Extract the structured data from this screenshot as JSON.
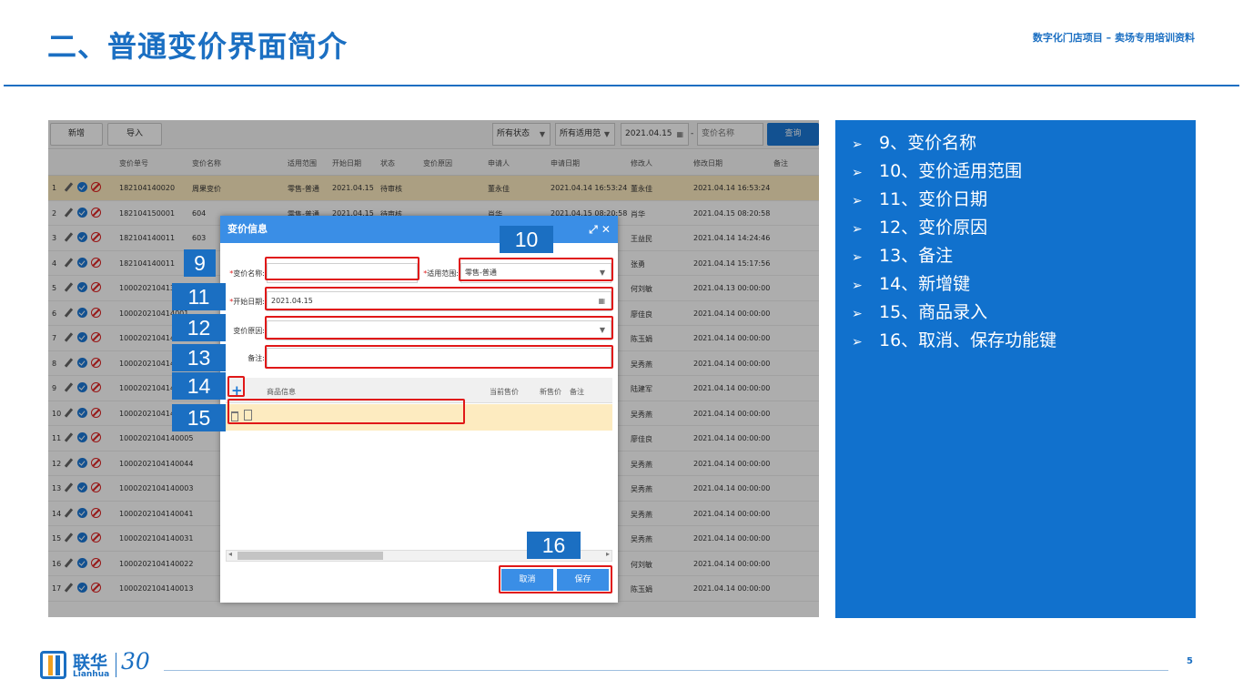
{
  "slide": {
    "title": "二、普通变价界面简介",
    "subtitle": "数字化门店项目 – 卖场专用培训资料",
    "page_number": "5"
  },
  "toolbar": {
    "add_label": "新增",
    "import_label": "导入",
    "status_filter": "所有状态",
    "scope_filter": "所有适用范",
    "date_value": "2021.04.15",
    "date_sep": "-",
    "name_placeholder": "变价名称",
    "query_label": "查询"
  },
  "grid": {
    "columns": [
      "变价单号",
      "变价名称",
      "适用范围",
      "开始日期",
      "状态",
      "变价原因",
      "申请人",
      "申请日期",
      "修改人",
      "修改日期",
      "备注"
    ],
    "rows": [
      {
        "num": "1",
        "order": "182104140020",
        "name": "周果变价",
        "scope": "零售-普通",
        "start": "2021.04.15",
        "status": "待审核",
        "applicant": "董永佳",
        "apply_date": "2021.04.14 16:53:24",
        "modifier": "董永佳",
        "mod_date": "2021.04.14 16:53:24"
      },
      {
        "num": "2",
        "order": "182104150001",
        "name": "604",
        "scope": "零售-普通",
        "start": "2021.04.15",
        "status": "待审核",
        "applicant": "肖华",
        "apply_date": "2021.04.15 08:20:58",
        "modifier": "肖华",
        "mod_date": "2021.04.15 08:20:58"
      },
      {
        "num": "3",
        "order": "182104140011",
        "name": "603",
        "scope": "",
        "start": "",
        "status": "",
        "applicant": "",
        "apply_date": "",
        "modifier": "王益民",
        "mod_date": "2021.04.14 14:24:46"
      },
      {
        "num": "4",
        "order": "182104140011",
        "name": "",
        "scope": "",
        "start": "",
        "status": "",
        "applicant": "",
        "apply_date": "",
        "modifier": "张勇",
        "mod_date": "2021.04.14 15:17:56"
      },
      {
        "num": "5",
        "order": "100020210413001",
        "name": "",
        "scope": "",
        "start": "",
        "status": "",
        "applicant": "",
        "apply_date": "",
        "modifier": "何刘敏",
        "mod_date": "2021.04.13 00:00:00"
      },
      {
        "num": "6",
        "order": "100020210414001",
        "name": "",
        "scope": "",
        "start": "",
        "status": "",
        "applicant": "",
        "apply_date": "",
        "modifier": "廖佳良",
        "mod_date": "2021.04.14 00:00:00"
      },
      {
        "num": "7",
        "order": "100020210414001",
        "name": "",
        "scope": "",
        "start": "",
        "status": "",
        "applicant": "",
        "apply_date": "",
        "modifier": "陈玉娟",
        "mod_date": "2021.04.14 00:00:00"
      },
      {
        "num": "8",
        "order": "100020210414001",
        "name": "",
        "scope": "",
        "start": "",
        "status": "",
        "applicant": "",
        "apply_date": "",
        "modifier": "吴秀燕",
        "mod_date": "2021.04.14 00:00:00"
      },
      {
        "num": "9",
        "order": "100020210414001",
        "name": "",
        "scope": "",
        "start": "",
        "status": "",
        "applicant": "",
        "apply_date": "",
        "modifier": "陆建军",
        "mod_date": "2021.04.14 00:00:00"
      },
      {
        "num": "10",
        "order": "100020210414001",
        "name": "",
        "scope": "",
        "start": "",
        "status": "",
        "applicant": "",
        "apply_date": "",
        "modifier": "吴秀燕",
        "mod_date": "2021.04.14 00:00:00"
      },
      {
        "num": "11",
        "order": "1000202104140005",
        "name": "",
        "scope": "",
        "start": "",
        "status": "",
        "applicant": "",
        "apply_date": "",
        "modifier": "廖佳良",
        "mod_date": "2021.04.14 00:00:00"
      },
      {
        "num": "12",
        "order": "1000202104140044",
        "name": "",
        "scope": "",
        "start": "",
        "status": "",
        "applicant": "",
        "apply_date": "",
        "modifier": "吴秀燕",
        "mod_date": "2021.04.14 00:00:00"
      },
      {
        "num": "13",
        "order": "1000202104140003",
        "name": "",
        "scope": "",
        "start": "",
        "status": "",
        "applicant": "",
        "apply_date": "",
        "modifier": "吴秀燕",
        "mod_date": "2021.04.14 00:00:00"
      },
      {
        "num": "14",
        "order": "1000202104140041",
        "name": "",
        "scope": "",
        "start": "",
        "status": "",
        "applicant": "",
        "apply_date": "",
        "modifier": "吴秀燕",
        "mod_date": "2021.04.14 00:00:00"
      },
      {
        "num": "15",
        "order": "1000202104140031",
        "name": "",
        "scope": "",
        "start": "",
        "status": "",
        "applicant": "",
        "apply_date": "",
        "modifier": "吴秀燕",
        "mod_date": "2021.04.14 00:00:00"
      },
      {
        "num": "16",
        "order": "1000202104140022",
        "name": "",
        "scope": "",
        "start": "",
        "status": "",
        "applicant": "",
        "apply_date": "",
        "modifier": "何刘敏",
        "mod_date": "2021.04.14 00:00:00"
      },
      {
        "num": "17",
        "order": "1000202104140013",
        "name": "",
        "scope": "",
        "start": "",
        "status": "",
        "applicant": "",
        "apply_date": "",
        "modifier": "陈玉娟",
        "mod_date": "2021.04.14 00:00:00"
      }
    ]
  },
  "dialog": {
    "title": "变价信息",
    "ctrl": "⤢ ✕",
    "name_label": "变价名称:",
    "scope_label": "适用范围:",
    "scope_value": "零售-普通",
    "start_label": "开始日期:",
    "start_value": "2021.04.15",
    "reason_label": "变价原因:",
    "note_label": "备注:",
    "req": "*",
    "grid_cols": [
      "商品信息",
      "当前售价",
      "新售价",
      "备注"
    ],
    "plus": "+",
    "cancel_label": "取消",
    "save_label": "保存",
    "scroll_left": "◂",
    "scroll_right": "▸"
  },
  "tags": [
    "9",
    "10",
    "11",
    "12",
    "13",
    "14",
    "15",
    "16"
  ],
  "right_panel": {
    "bullet": "➢",
    "items": [
      "9、变价名称",
      "10、变价适用范围",
      "11、变价日期",
      "12、变价原因",
      "13、备注",
      "14、新增键",
      "15、商品录入",
      "16、取消、保存功能键"
    ]
  },
  "footer": {
    "logo_cn": "联华",
    "logo_en": "Lianhua",
    "logo_30": "30"
  },
  "colors": {
    "brand_blue": "#1b6fc2",
    "panel_blue": "#1171cd",
    "highlight_red": "#e01818",
    "row_highlight": "#fdebc0"
  }
}
